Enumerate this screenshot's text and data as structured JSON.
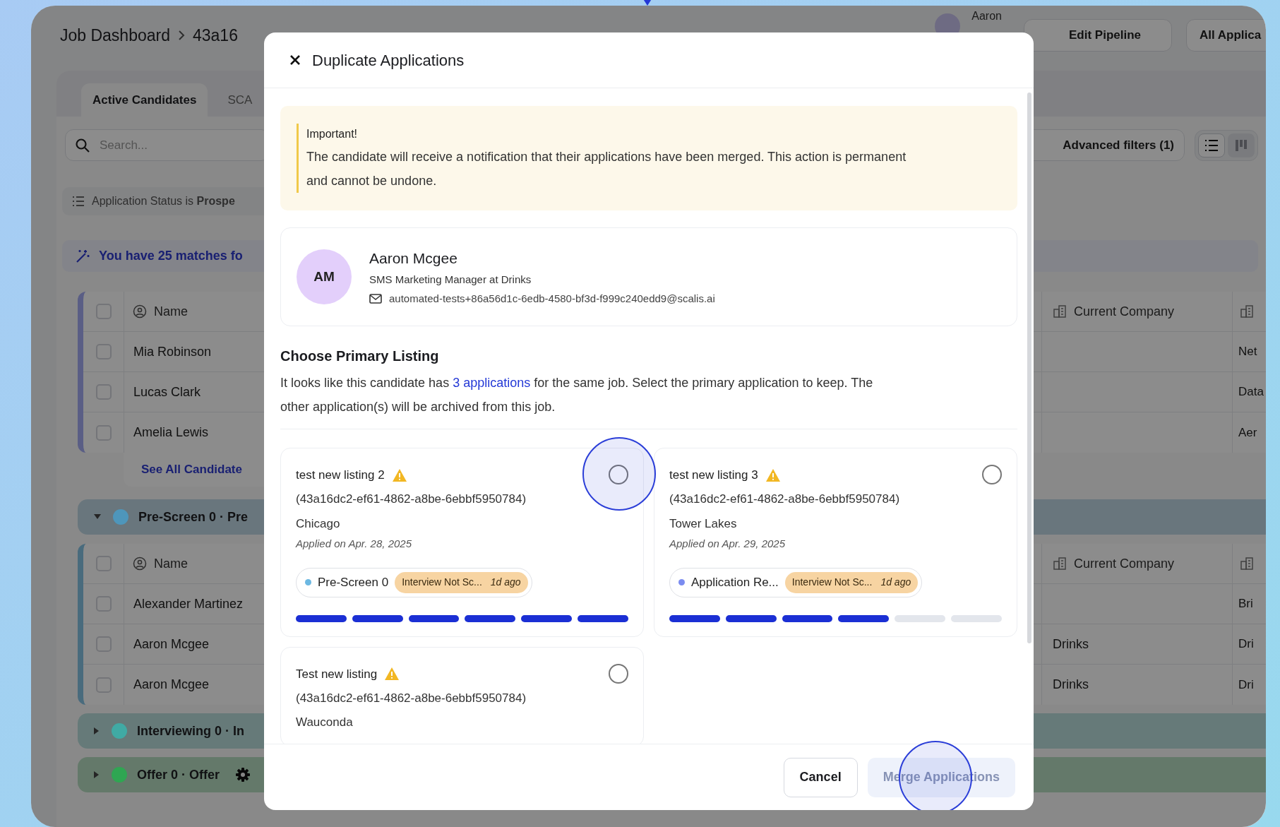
{
  "dashboard": {
    "breadcrumb": [
      "Job Dashboard",
      "43a16"
    ],
    "user": {
      "name": "Aaron"
    },
    "header_buttons": [
      "Edit Pipeline",
      "All Applica"
    ],
    "tabs": [
      {
        "label": "Active Candidates",
        "selected": true
      },
      {
        "label": "SCA",
        "selected": false
      }
    ],
    "search": {
      "placeholder": "Search..."
    },
    "advanced_filters": "Advanced filters (1)",
    "view_toggle": [
      {
        "kind": "list",
        "selected": true
      },
      {
        "kind": "board",
        "selected": false
      }
    ],
    "filter_chip": "Application Status is **Prospe**",
    "matches_banner": "You have 25 matches fo",
    "groups": [
      {
        "kind": "table",
        "color": "#a5abf2",
        "columns": [
          {
            "label": "Name"
          },
          {
            "label": "Current Company"
          }
        ],
        "all_checked": false,
        "rows": [
          {
            "checked": false,
            "name": "Mia Robinson",
            "column_3": "Net"
          },
          {
            "checked": false,
            "name": "Lucas Clark",
            "column_3": "Data"
          },
          {
            "checked": false,
            "name": "Amelia Lewis",
            "column_3": "Aer"
          }
        ],
        "link": "See All Candidate"
      },
      {
        "kind": "stage",
        "label": "Pre-Screen 0 · Pre",
        "expanded": true,
        "color": "#4e96bb",
        "settings": false
      },
      {
        "kind": "table",
        "color": "#86c3e3",
        "columns": [
          {
            "label": "Name"
          },
          {
            "label": "Current Company"
          }
        ],
        "all_checked": false,
        "rows": [
          {
            "checked": false,
            "name": "Alexander Martinez",
            "column_3": "Bri"
          },
          {
            "checked": false,
            "name": "Aaron Mcgee",
            "company": "Drinks",
            "column_3": "Dri"
          },
          {
            "checked": false,
            "name": "Aaron Mcgee",
            "company": "Drinks",
            "column_3": "Dri"
          }
        ]
      },
      {
        "kind": "stage",
        "label": "Interviewing 0 · In",
        "expanded": false,
        "color": "#40aaa4",
        "settings": false
      },
      {
        "kind": "stage",
        "label": "Offer 0 · Offer",
        "expanded": false,
        "color": "#2fa652",
        "settings": true
      }
    ]
  },
  "modal": {
    "title": "Duplicate Applications",
    "alert": {
      "title": "Important!",
      "text": "The candidate will receive a notification that their applications have been merged. This action is permanent and cannot be undone."
    },
    "candidate": {
      "initials": "AM",
      "name": "Aaron Mcgee",
      "headline": "SMS Marketing Manager at Drinks",
      "email": "automated-tests+86a56d1c-6edb-4580-bf3d-f999c240edd9@scalis.ai"
    },
    "section_title": "Choose Primary Listing",
    "description_before": "It looks like this candidate has ",
    "description_link": "3 applications",
    "description_after": " for the same job. Select the primary application to keep. The other application(s) will be archived from this job.",
    "listings": [
      {
        "title": "test new listing 2",
        "warning": true,
        "job_id": "(43a16dc2-ef61-4862-a8be-6ebbf5950784)",
        "location": "Chicago",
        "applied": "Applied on Apr. 28, 2025",
        "selected": false,
        "click_highlight": true,
        "stage": {
          "label": "Pre-Screen 0",
          "color": "#6cb8e2"
        },
        "status": {
          "label": "Interview Not Sc...",
          "time": "1d ago"
        },
        "steps": [
          {
            "done": true
          },
          {
            "done": true
          },
          {
            "done": true
          },
          {
            "done": true
          },
          {
            "done": true
          },
          {
            "done": true
          }
        ]
      },
      {
        "title": "test new listing 3",
        "warning": true,
        "job_id": "(43a16dc2-ef61-4862-a8be-6ebbf5950784)",
        "location": "Tower Lakes",
        "applied": "Applied on Apr. 29, 2025",
        "selected": false,
        "click_highlight": false,
        "stage": {
          "label": "Application Re...",
          "color": "#7b8cf0"
        },
        "status": {
          "label": "Interview Not Sc...",
          "time": "1d ago"
        },
        "steps": [
          {
            "done": true
          },
          {
            "done": true
          },
          {
            "done": true
          },
          {
            "done": true
          },
          {
            "done": false
          },
          {
            "done": false
          }
        ]
      },
      {
        "title": "Test new listing",
        "warning": true,
        "job_id": "(43a16dc2-ef61-4862-a8be-6ebbf5950784)",
        "location": "Wauconda",
        "selected": false,
        "click_highlight": false
      }
    ],
    "buttons": [
      {
        "label": "Cancel",
        "kind": "secondary",
        "disabled": false,
        "click_highlight": false
      },
      {
        "label": "Merge Applications",
        "kind": "primary",
        "disabled": true,
        "click_highlight": true
      }
    ]
  }
}
